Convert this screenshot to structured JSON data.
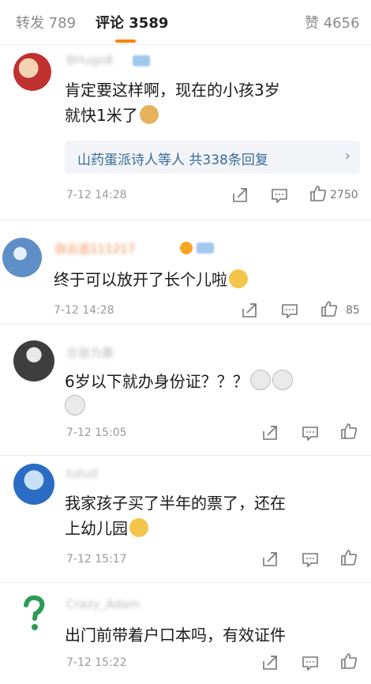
{
  "tabs": {
    "repost": "转发 789",
    "comments": "评论 3589",
    "likes": "赞 4656"
  },
  "comments": [
    {
      "username": "BHugo8",
      "text": "肯定要这样啊，现在的小孩3岁\n就快1米了",
      "reply_summary": "山药蛋派诗人等人 共338条回复",
      "reply_chevron": "›",
      "time": "7-12 14:28",
      "likes": "2750"
    },
    {
      "username": "自云追111217",
      "text": "终于可以放开了长个儿啦",
      "time": "7-12 14:28",
      "likes": "85"
    },
    {
      "username": "念张为慕",
      "text": "6岁以下就办身份证？？？",
      "time": "7-12 15:05",
      "likes": ""
    },
    {
      "username": "tutu0",
      "text": "我家孩子买了半年的票了，还在\n上幼儿园",
      "time": "7-12 15:17",
      "likes": ""
    },
    {
      "username": "Crazy_Adam",
      "text": "出门前带着户口本吗，有效证件",
      "time": "7-12 15:22",
      "likes": ""
    }
  ],
  "colors": {
    "accent": "#ff8200",
    "link": "#3a6c9c",
    "muted": "#9a9a9a"
  },
  "icons": {
    "repost": "share-icon",
    "comment": "comment-icon",
    "like": "thumbs-up-icon"
  }
}
